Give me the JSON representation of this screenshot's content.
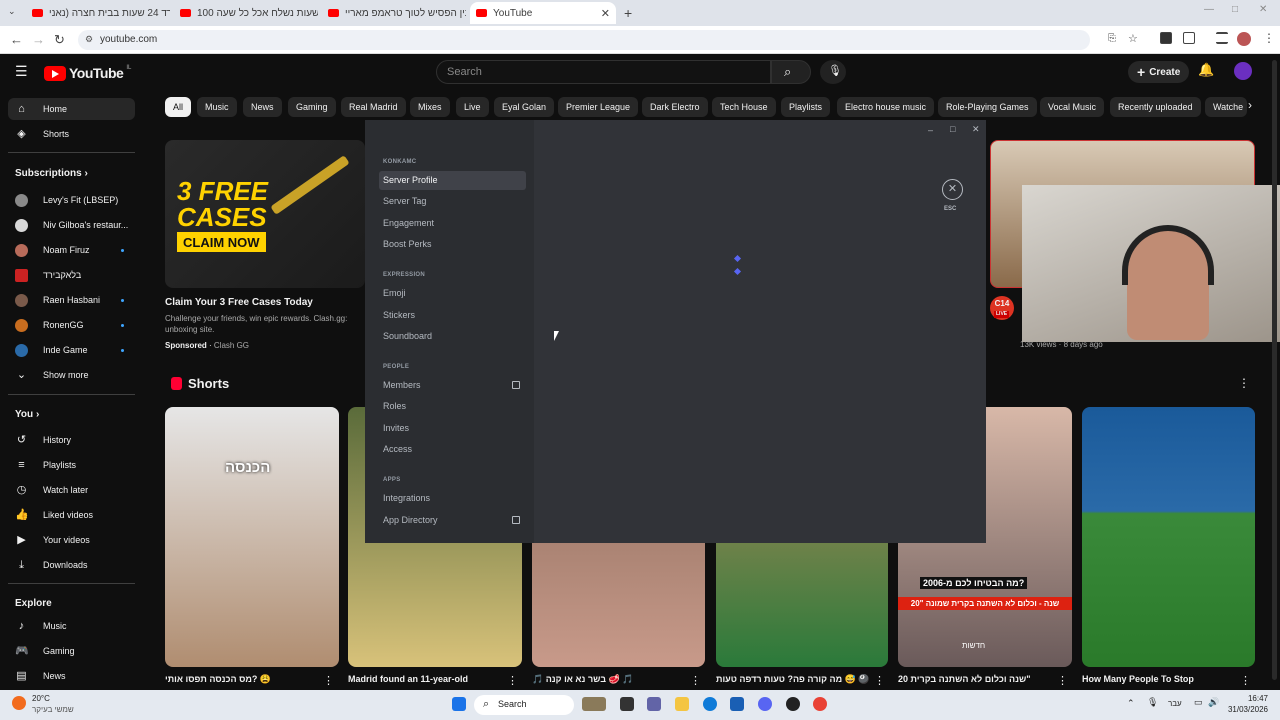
{
  "browser": {
    "tabs": [
      {
        "label": "שורד 24 שעות בבית חצרה (נאני!"
      },
      {
        "label": "100 שעות נשלח אכל כל שעה ..."
      },
      {
        "label": "בין הפסיש לטוך טראמפ מאריי"
      },
      {
        "label": "YouTube"
      }
    ],
    "new_tab": "+",
    "url": "youtube.com"
  },
  "youtube": {
    "logo_text": "YouTube",
    "country_code": "IL",
    "search_placeholder": "Search",
    "create_label": "Create",
    "chips": [
      "All",
      "Music",
      "News",
      "Gaming",
      "Real Madrid",
      "Mixes",
      "Live",
      "Eyal Golan",
      "Premier League",
      "Dark Electro",
      "Tech House",
      "Playlists",
      "Electro house music",
      "Role-Playing Games",
      "Vocal Music",
      "Recently uploaded",
      "Watche"
    ],
    "sidebar": {
      "home": "Home",
      "shorts": "Shorts",
      "subscriptions": "Subscriptions",
      "subs": [
        {
          "label": "Levy's Fit (LBSEP)",
          "color": "#8a8a8a"
        },
        {
          "label": "Niv Gilboa's restaur...",
          "color": "#d8d8d8"
        },
        {
          "label": "Noam Firuz",
          "color": "#b86b5a"
        },
        {
          "label": "בלאקבירד",
          "color": "#cc2222"
        },
        {
          "label": "Raen Hasbani",
          "color": "#7a5a4a"
        },
        {
          "label": "RonenGG",
          "color": "#c86d1f"
        },
        {
          "label": "Inde Game",
          "color": "#2a6aa8"
        }
      ],
      "show_more": "Show more",
      "you": "You",
      "you_items": [
        "History",
        "Playlists",
        "Watch later",
        "Liked videos",
        "Your videos",
        "Downloads"
      ],
      "explore": "Explore",
      "explore_items": [
        "Music",
        "Gaming",
        "News"
      ]
    },
    "ad": {
      "banner_line1": "3 FREE",
      "banner_line2": "CASES",
      "banner_cta": "CLAIM NOW",
      "title": "Claim Your 3 Free Cases Today",
      "desc": "Challenge your friends, win epic rewards. Clash.gg: unboxing site.",
      "sponsored": "Sponsored",
      "advertiser": "Clash GG"
    },
    "right_video": {
      "views": "13K views · 8 days ago",
      "live_badge": "C14",
      "live_label": "LIVE"
    },
    "shorts_heading": "Shorts",
    "shorts": [
      {
        "title": "מס הכנסה תפסו אותי? 😩",
        "overlay": "הכנסה"
      },
      {
        "title": "Madrid found an 11-year-old"
      },
      {
        "title": "🎵 בשר נא או קנה 🥩 🎵"
      },
      {
        "title": "מה קורה פה? טעות רדפה טעות 😅 🎱"
      },
      {
        "title": "שנה וכלום לא השתנה בקרית 20\"",
        "overlay": "מה הבטיחו לכם מ-2006?",
        "overlay2": "20\" שנה - וכלום לא השתנה בקרית שמונה",
        "source": "חדשות"
      },
      {
        "title": "How Many People To Stop"
      }
    ]
  },
  "discord_modal": {
    "window_controls": [
      "–",
      "□",
      "✕"
    ],
    "section_server": "KONKAMC",
    "server_items": [
      "Server Profile",
      "Server Tag",
      "Engagement",
      "Boost Perks"
    ],
    "section_expression": "EXPRESSION",
    "expression_items": [
      "Emoji",
      "Stickers",
      "Soundboard"
    ],
    "section_people": "PEOPLE",
    "people_items": [
      "Members",
      "Roles",
      "Invites",
      "Access"
    ],
    "section_apps": "APPS",
    "apps_items": [
      "Integrations",
      "App Directory"
    ],
    "esc_label": "ESC",
    "close_glyph": "✕"
  },
  "taskbar": {
    "weather_temp": "20°C",
    "weather_desc": "שמשי בעיקר",
    "search_label": "Search",
    "lang": "עבר",
    "time": "16:47",
    "date": "31/03/2026"
  }
}
